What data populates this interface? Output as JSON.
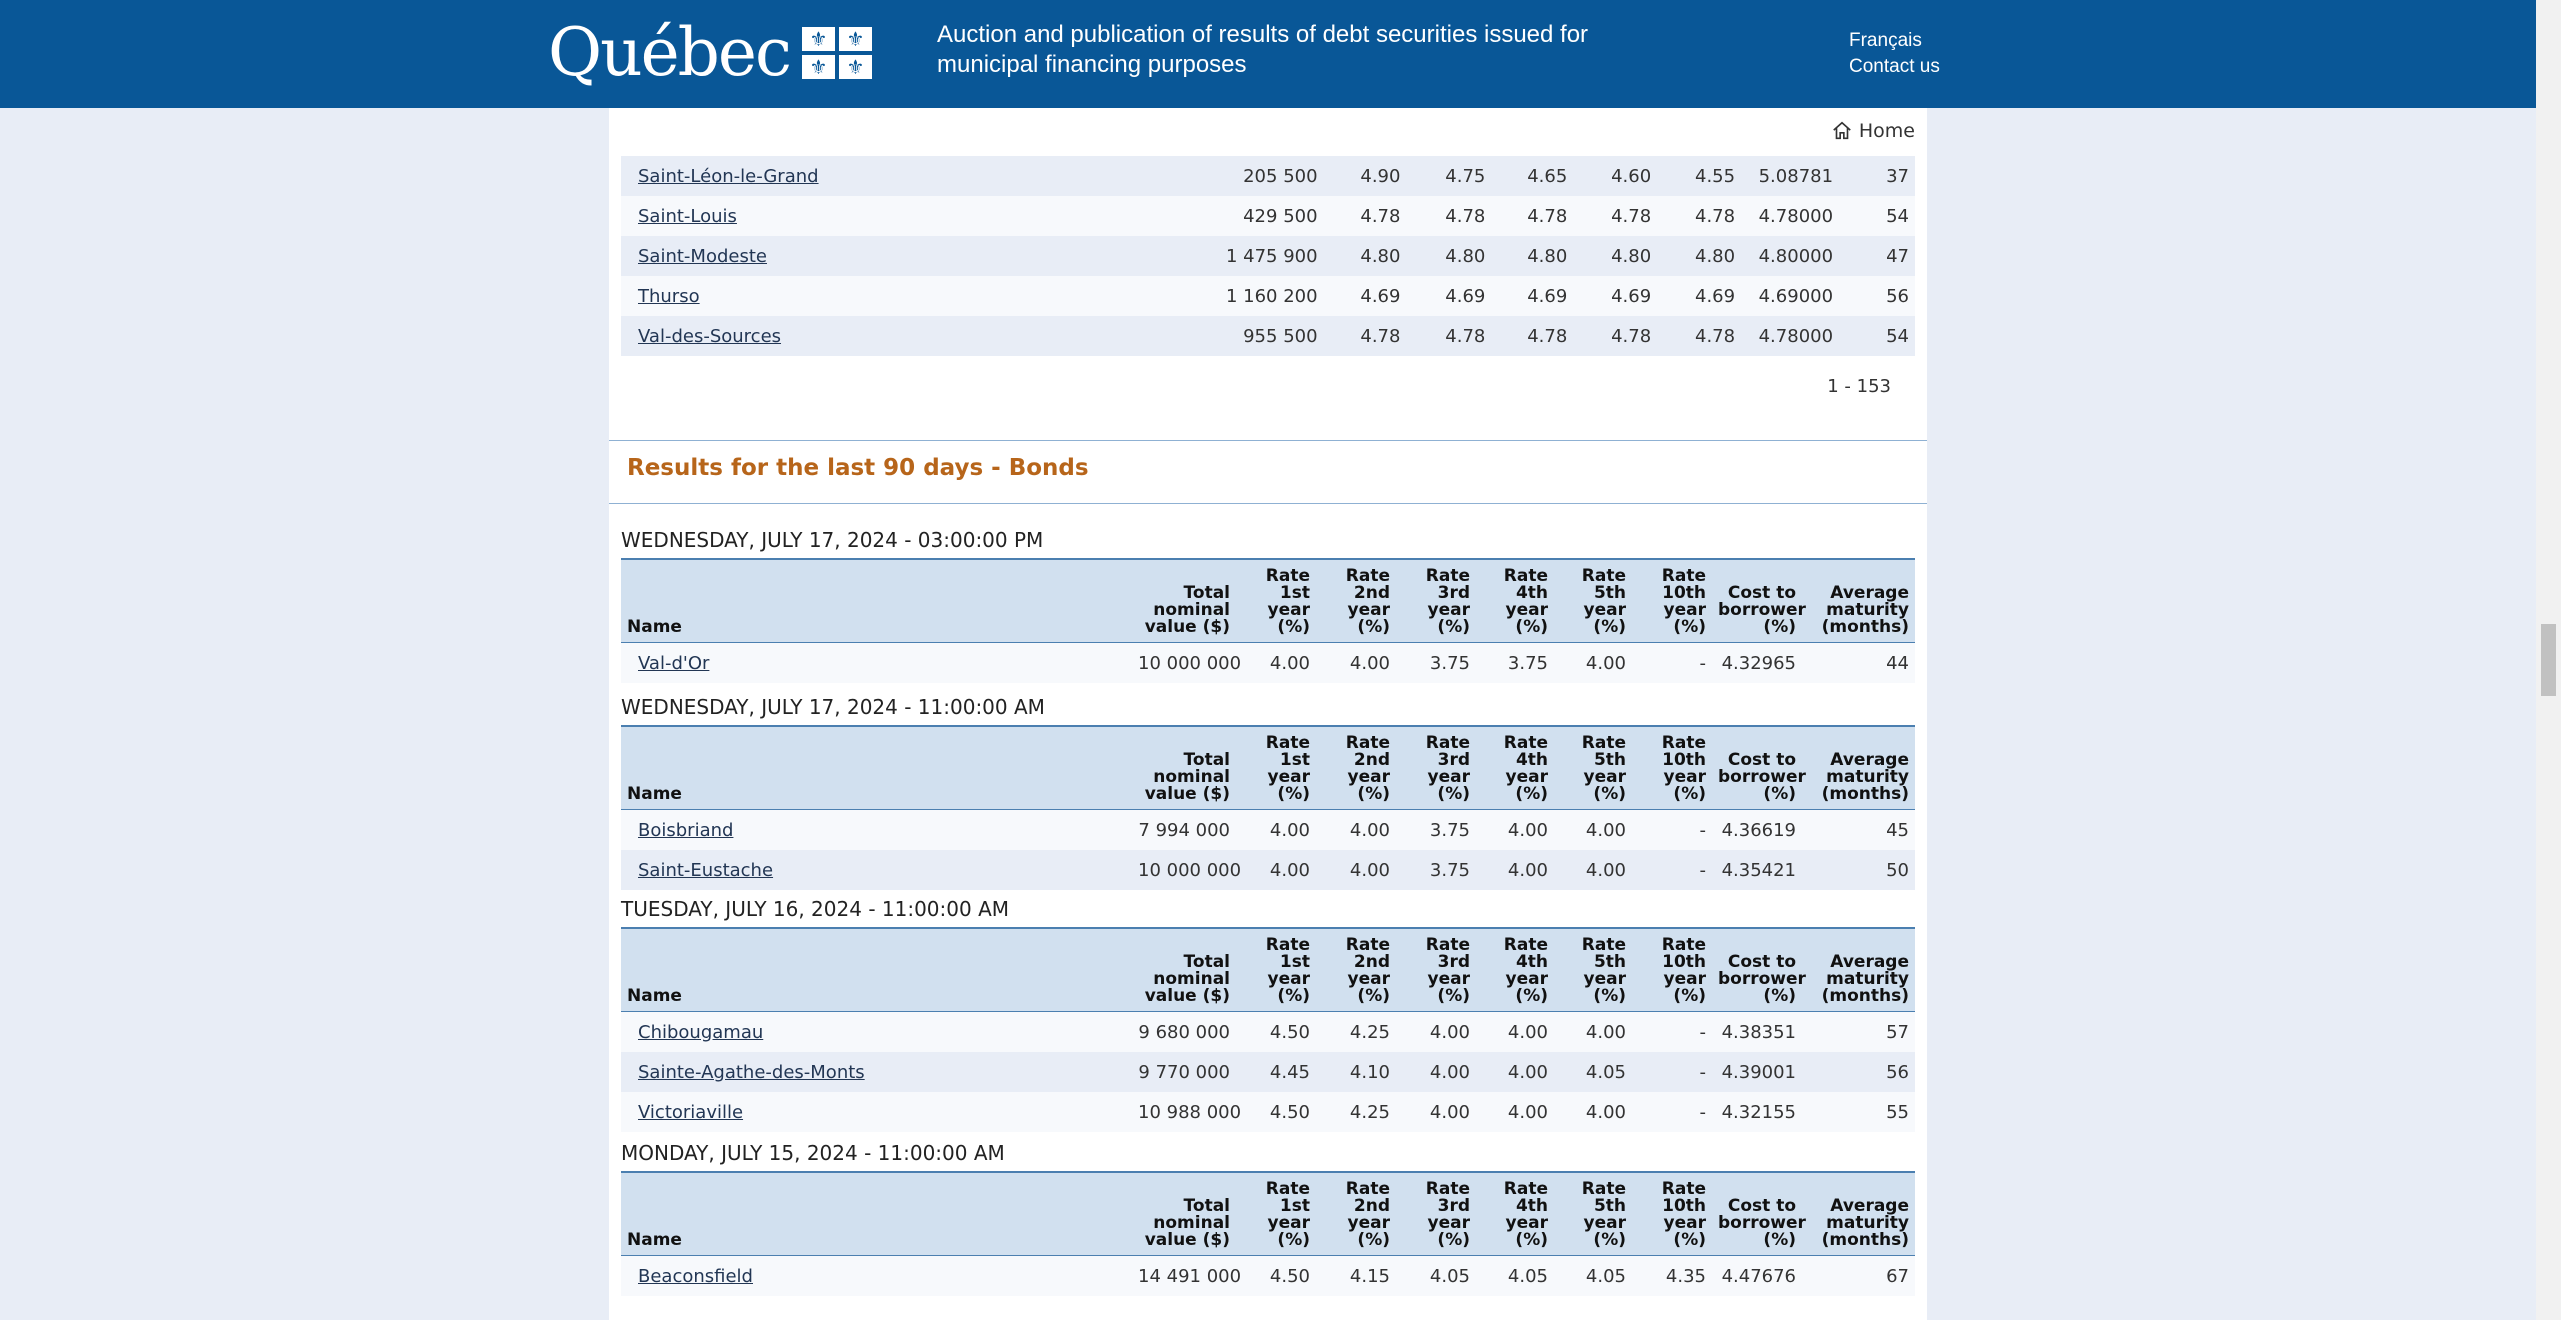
{
  "header": {
    "logo_text": "Québec",
    "site_title": "Auction and publication of results of debt securities issued for municipal financing purposes",
    "lang_link": "Français",
    "contact_link": "Contact us"
  },
  "home_label": "Home",
  "top_rows": [
    [
      "Saint-Léon-le-Grand",
      "205 500",
      "4.90",
      "4.75",
      "4.65",
      "4.60",
      "4.55",
      "5.08781",
      "37"
    ],
    [
      "Saint-Louis",
      "429 500",
      "4.78",
      "4.78",
      "4.78",
      "4.78",
      "4.78",
      "4.78000",
      "54"
    ],
    [
      "Saint-Modeste",
      "1 475 900",
      "4.80",
      "4.80",
      "4.80",
      "4.80",
      "4.80",
      "4.80000",
      "47"
    ],
    [
      "Thurso",
      "1 160 200",
      "4.69",
      "4.69",
      "4.69",
      "4.69",
      "4.69",
      "4.69000",
      "56"
    ],
    [
      "Val-des-Sources",
      "955 500",
      "4.78",
      "4.78",
      "4.78",
      "4.78",
      "4.78",
      "4.78000",
      "54"
    ]
  ],
  "pager": "1 - 153",
  "section_title": "Results for the last 90 days - Bonds",
  "columns": [
    "Name",
    "Total nominal value ($)",
    "Rate 1st year (%)",
    "Rate 2nd year (%)",
    "Rate 3rd year (%)",
    "Rate 4th year (%)",
    "Rate 5th year (%)",
    "Rate 10th year (%)",
    "Cost to borrower (%)",
    "Average maturity (months)"
  ],
  "groups": [
    {
      "date": "WEDNESDAY, JULY 17, 2024 - 03:00:00 PM",
      "rows": [
        [
          "Val-d'Or",
          "10 000 000",
          "4.00",
          "4.00",
          "3.75",
          "3.75",
          "4.00",
          "-",
          "4.32965",
          "44"
        ]
      ]
    },
    {
      "date": "WEDNESDAY, JULY 17, 2024 - 11:00:00 AM",
      "rows": [
        [
          "Boisbriand",
          "7 994 000",
          "4.00",
          "4.00",
          "3.75",
          "4.00",
          "4.00",
          "-",
          "4.36619",
          "45"
        ],
        [
          "Saint-Eustache",
          "10 000 000",
          "4.00",
          "4.00",
          "3.75",
          "4.00",
          "4.00",
          "-",
          "4.35421",
          "50"
        ]
      ]
    },
    {
      "date": "TUESDAY, JULY 16, 2024 - 11:00:00 AM",
      "rows": [
        [
          "Chibougamau",
          "9 680 000",
          "4.50",
          "4.25",
          "4.00",
          "4.00",
          "4.00",
          "-",
          "4.38351",
          "57"
        ],
        [
          "Sainte-Agathe-des-Monts",
          "9 770 000",
          "4.45",
          "4.10",
          "4.00",
          "4.00",
          "4.05",
          "-",
          "4.39001",
          "56"
        ],
        [
          "Victoriaville",
          "10 988 000",
          "4.50",
          "4.25",
          "4.00",
          "4.00",
          "4.00",
          "-",
          "4.32155",
          "55"
        ]
      ]
    },
    {
      "date": "MONDAY, JULY 15, 2024 - 11:00:00 AM",
      "rows": [
        [
          "Beaconsfield",
          "14 491 000",
          "4.50",
          "4.15",
          "4.05",
          "4.05",
          "4.05",
          "4.35",
          "4.47676",
          "67"
        ]
      ]
    }
  ]
}
